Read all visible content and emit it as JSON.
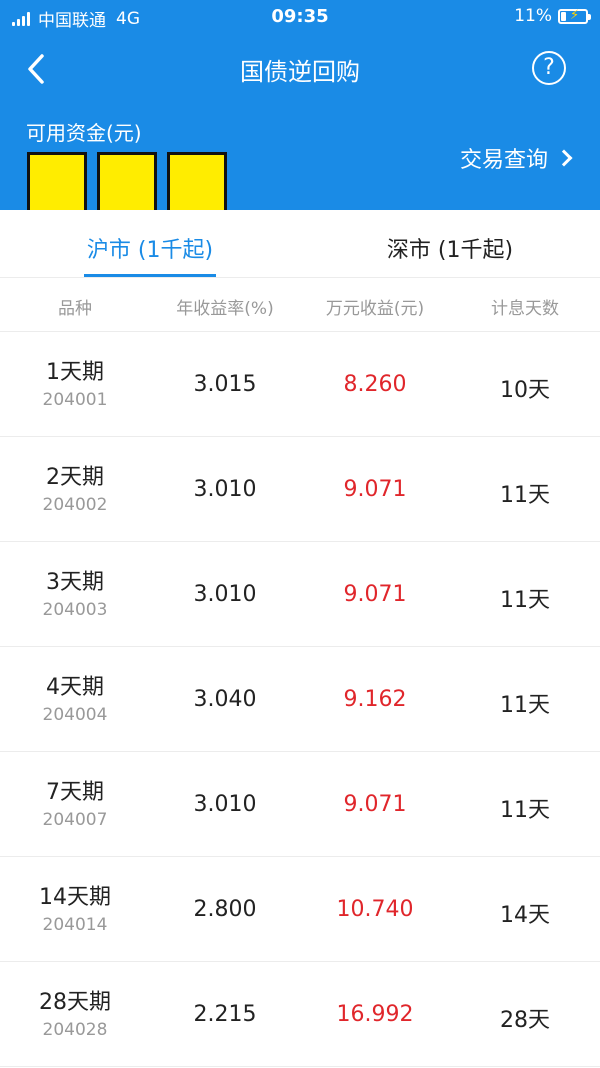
{
  "status_bar": {
    "carrier": "中国联通",
    "network": "4G",
    "time": "09:35",
    "battery": "11%"
  },
  "nav": {
    "title": "国债逆回购",
    "back_icon": "chevron-left-icon",
    "help_icon": "question-circle-icon",
    "help_glyph": "?"
  },
  "account": {
    "funds_label": "可用资金(元)",
    "trade_query": "交易查询"
  },
  "tabs": [
    {
      "label": "沪市 (1千起)",
      "active": true
    },
    {
      "label": "深市 (1千起)",
      "active": false
    }
  ],
  "columns": [
    "品种",
    "年收益率(%)",
    "万元收益(元)",
    "计息天数"
  ],
  "rows": [
    {
      "name": "1天期",
      "code": "204001",
      "rate": "3.015",
      "yield": "8.260",
      "days": "10天"
    },
    {
      "name": "2天期",
      "code": "204002",
      "rate": "3.010",
      "yield": "9.071",
      "days": "11天"
    },
    {
      "name": "3天期",
      "code": "204003",
      "rate": "3.010",
      "yield": "9.071",
      "days": "11天"
    },
    {
      "name": "4天期",
      "code": "204004",
      "rate": "3.040",
      "yield": "9.162",
      "days": "11天"
    },
    {
      "name": "7天期",
      "code": "204007",
      "rate": "3.010",
      "yield": "9.071",
      "days": "11天"
    },
    {
      "name": "14天期",
      "code": "204014",
      "rate": "2.800",
      "yield": "10.740",
      "days": "14天"
    },
    {
      "name": "28天期",
      "code": "204028",
      "rate": "2.215",
      "yield": "16.992",
      "days": "28天"
    }
  ],
  "colors": {
    "brand_blue": "#1a8be6",
    "yield_red": "#e0262b"
  }
}
